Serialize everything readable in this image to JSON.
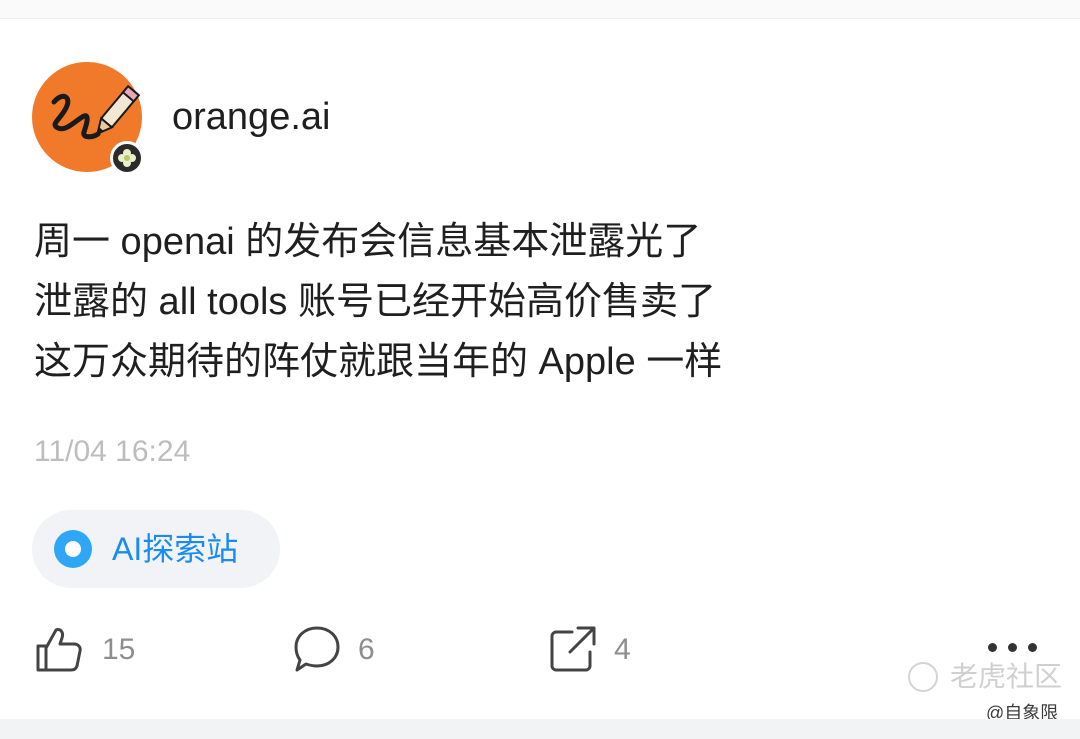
{
  "author": {
    "name": "orange.ai"
  },
  "post": {
    "lines": [
      "周一 openai 的发布会信息基本泄露光了",
      "泄露的 all tools 账号已经开始高价售卖了",
      "这万众期待的阵仗就跟当年的 Apple 一样"
    ],
    "timestamp": "11/04 16:24"
  },
  "topic": {
    "label": "AI探索站"
  },
  "actions": {
    "likes": "15",
    "comments": "6",
    "shares": "4"
  },
  "watermark": {
    "text": "老虎社区",
    "credit": "@自象限"
  },
  "colors": {
    "avatar_bg": "#f07a2a",
    "topic_accent": "#1a8cf0",
    "timestamp": "#bdbdbd"
  },
  "icons": [
    "pencil-doodle-avatar",
    "flower-badge-icon",
    "like-icon",
    "comment-icon",
    "share-icon",
    "more-icon"
  ]
}
